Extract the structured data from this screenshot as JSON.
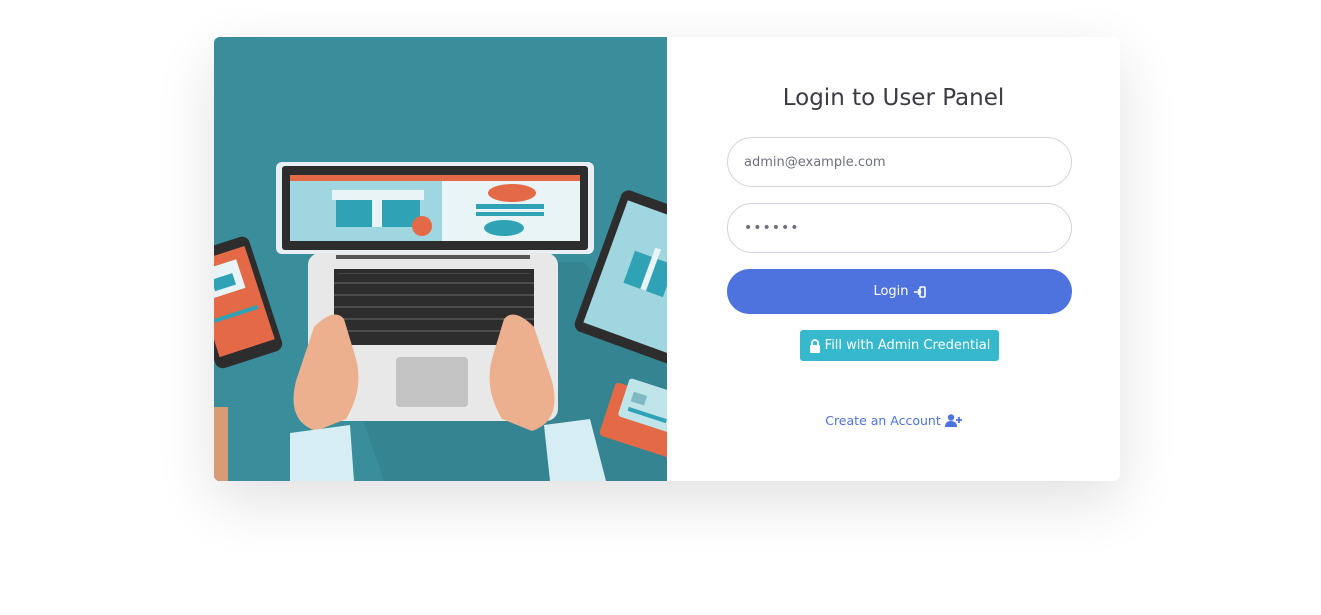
{
  "panel": {
    "title": "Login to User Panel"
  },
  "form": {
    "email_value": "admin@example.com",
    "password_value": "••••••",
    "login_label": "Login",
    "fill_admin_label": "Fill with Admin Credential",
    "create_account_label": "Create an Account"
  },
  "icons": {
    "login": "sign-in-icon",
    "fill_admin": "lock-icon",
    "create_account": "user-plus-icon"
  },
  "colors": {
    "primary": "#4e73df",
    "info": "#36b9cc",
    "illustration_bg": "#3a8e9c"
  }
}
